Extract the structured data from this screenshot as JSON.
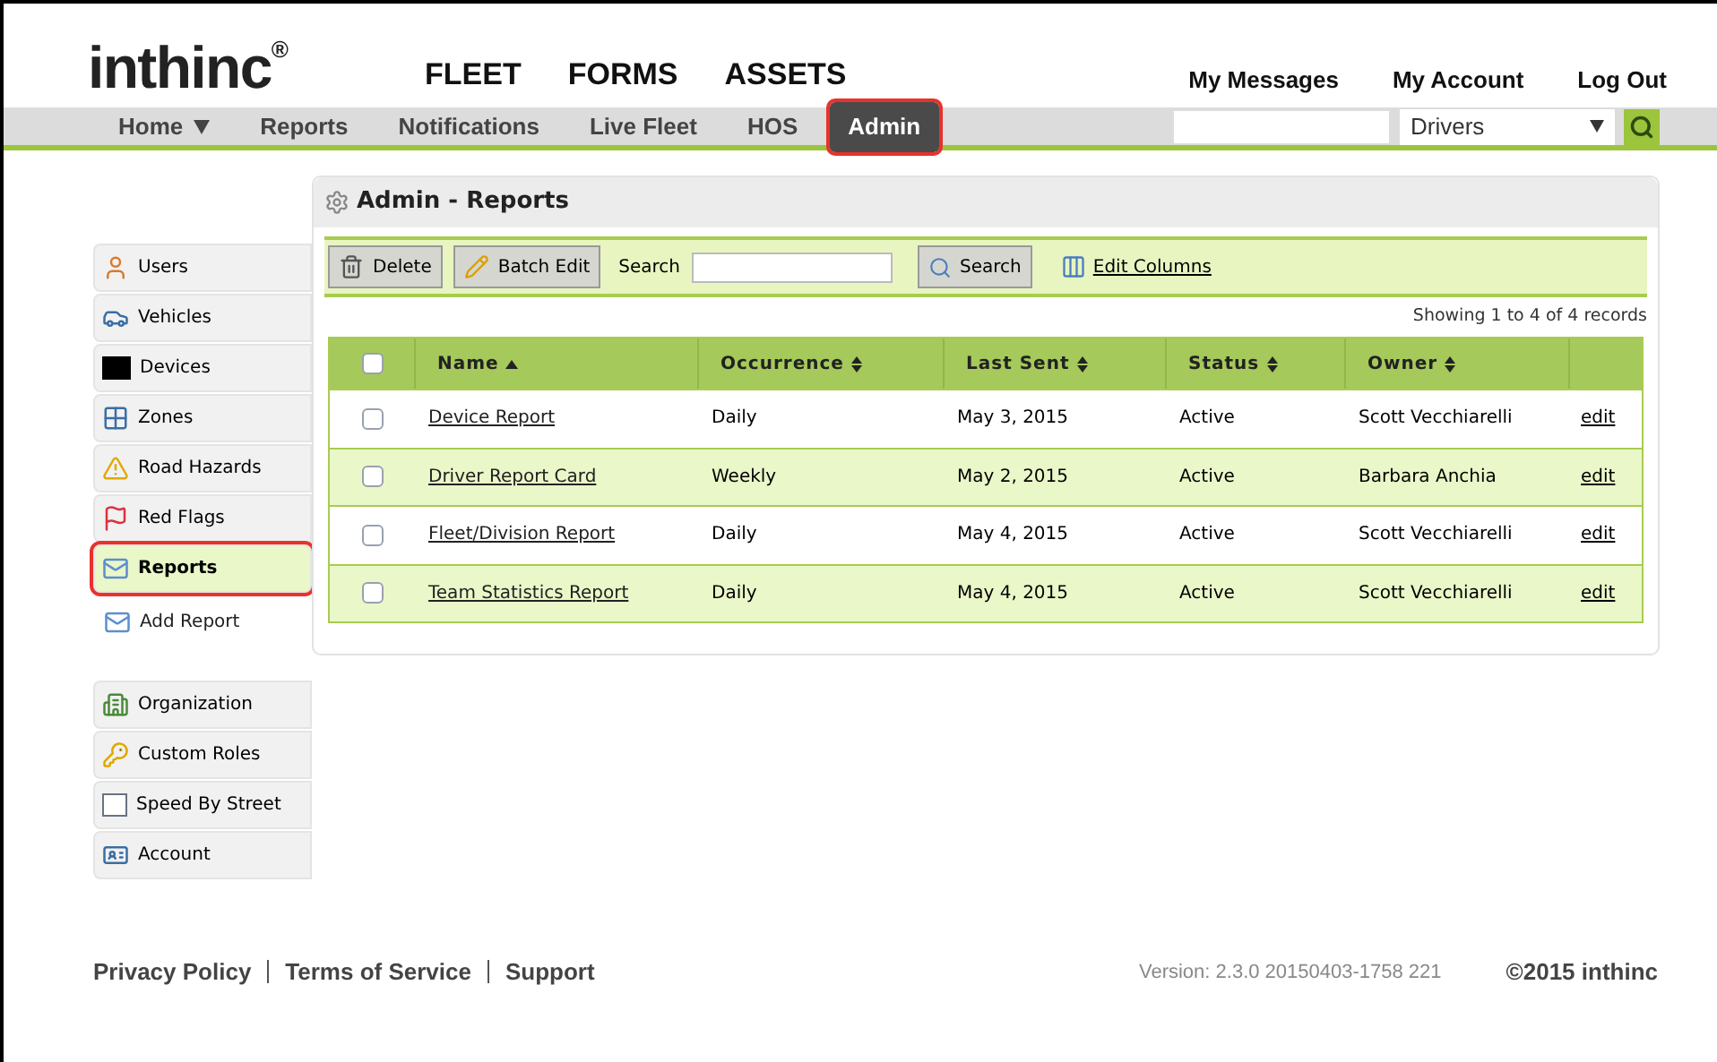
{
  "logo": {
    "text": "inthinc",
    "mark": "®"
  },
  "top_nav": [
    "FLEET",
    "FORMS",
    "ASSETS"
  ],
  "account_links": [
    "My Messages",
    "My Account",
    "Log Out"
  ],
  "nav_tabs": [
    {
      "label": "Home",
      "dropdown": true,
      "selected": false,
      "highlighted": false
    },
    {
      "label": "Reports",
      "dropdown": false,
      "selected": false,
      "highlighted": false
    },
    {
      "label": "Notifications",
      "dropdown": false,
      "selected": false,
      "highlighted": false
    },
    {
      "label": "Live Fleet",
      "dropdown": false,
      "selected": false,
      "highlighted": false
    },
    {
      "label": "HOS",
      "dropdown": false,
      "selected": false,
      "highlighted": false
    },
    {
      "label": "Admin",
      "dropdown": false,
      "selected": true,
      "highlighted": true
    }
  ],
  "global_search": {
    "scope": "Drivers"
  },
  "sidebar": {
    "groups": [
      [
        {
          "label": "Users",
          "selected": false,
          "highlighted": false
        },
        {
          "label": "Vehicles",
          "selected": false,
          "highlighted": false
        },
        {
          "label": "Devices",
          "selected": false,
          "highlighted": false
        },
        {
          "label": "Zones",
          "selected": false,
          "highlighted": false
        },
        {
          "label": "Road Hazards",
          "selected": false,
          "highlighted": false
        },
        {
          "label": "Red Flags",
          "selected": false,
          "highlighted": false
        },
        {
          "label": "Reports",
          "selected": true,
          "highlighted": true
        }
      ],
      [
        {
          "label": "Organization",
          "selected": false,
          "highlighted": false
        },
        {
          "label": "Custom Roles",
          "selected": false,
          "highlighted": false
        },
        {
          "label": "Speed By Street",
          "selected": false,
          "highlighted": false
        },
        {
          "label": "Account",
          "selected": false,
          "highlighted": false
        }
      ]
    ],
    "sub_action": "Add Report"
  },
  "panel": {
    "title": "Admin - Reports",
    "toolbar": {
      "delete": "Delete",
      "batch_edit": "Batch Edit",
      "search_label": "Search",
      "search_button": "Search",
      "edit_columns": "Edit Columns"
    },
    "summary": "Showing 1 to 4 of 4 records",
    "table": {
      "header_checked": false,
      "columns": [
        {
          "label": "Name",
          "sorted": true
        },
        {
          "label": "Occurrence",
          "sorted": false
        },
        {
          "label": "Last Sent",
          "sorted": false
        },
        {
          "label": "Status",
          "sorted": false
        },
        {
          "label": "Owner",
          "sorted": false
        }
      ],
      "rows": [
        {
          "checked": false,
          "name": "Device Report",
          "occurrence": "Daily",
          "last_sent": "May 3, 2015",
          "status": "Active",
          "owner": "Scott Vecchiarelli",
          "action": "edit"
        },
        {
          "checked": false,
          "name": "Driver Report Card",
          "occurrence": "Weekly",
          "last_sent": "May 2, 2015",
          "status": "Active",
          "owner": "Barbara Anchia",
          "action": "edit"
        },
        {
          "checked": false,
          "name": "Fleet/Division Report",
          "occurrence": "Daily",
          "last_sent": "May 4, 2015",
          "status": "Active",
          "owner": "Scott Vecchiarelli",
          "action": "edit"
        },
        {
          "checked": false,
          "name": "Team Statistics Report",
          "occurrence": "Daily",
          "last_sent": "May 4, 2015",
          "status": "Active",
          "owner": "Scott Vecchiarelli",
          "action": "edit"
        }
      ]
    }
  },
  "footer": {
    "links": [
      "Privacy Policy",
      "Terms of Service",
      "Support"
    ],
    "version": "Version: 2.3.0 20150403-1758 221",
    "copyright": "©2015 inthinc"
  }
}
